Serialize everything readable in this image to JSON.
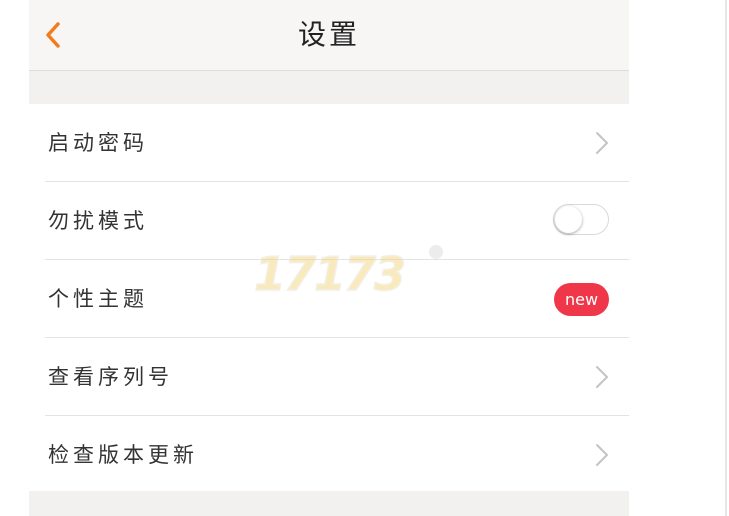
{
  "navbar": {
    "back_icon": "chevron-left-icon",
    "title": "设置"
  },
  "settings": {
    "items": [
      {
        "label": "启动密码",
        "control": "chevron-right-icon"
      },
      {
        "label": "勿扰模式",
        "control": "toggle-switch",
        "toggle_on": false
      },
      {
        "label": "个性主题",
        "control": "badge",
        "badge_text": "new"
      },
      {
        "label": "查看序列号",
        "control": "chevron-right-icon"
      },
      {
        "label": "检查版本更新",
        "control": "chevron-right-icon"
      }
    ]
  },
  "watermark": {
    "text": "17173"
  },
  "colors": {
    "accent_orange": "#f07c1e",
    "badge_red": "#f0374a",
    "background": "#f2f1f0",
    "navbar_bg": "#f7f6f5",
    "watermark_yellow": "#f5d98a"
  }
}
